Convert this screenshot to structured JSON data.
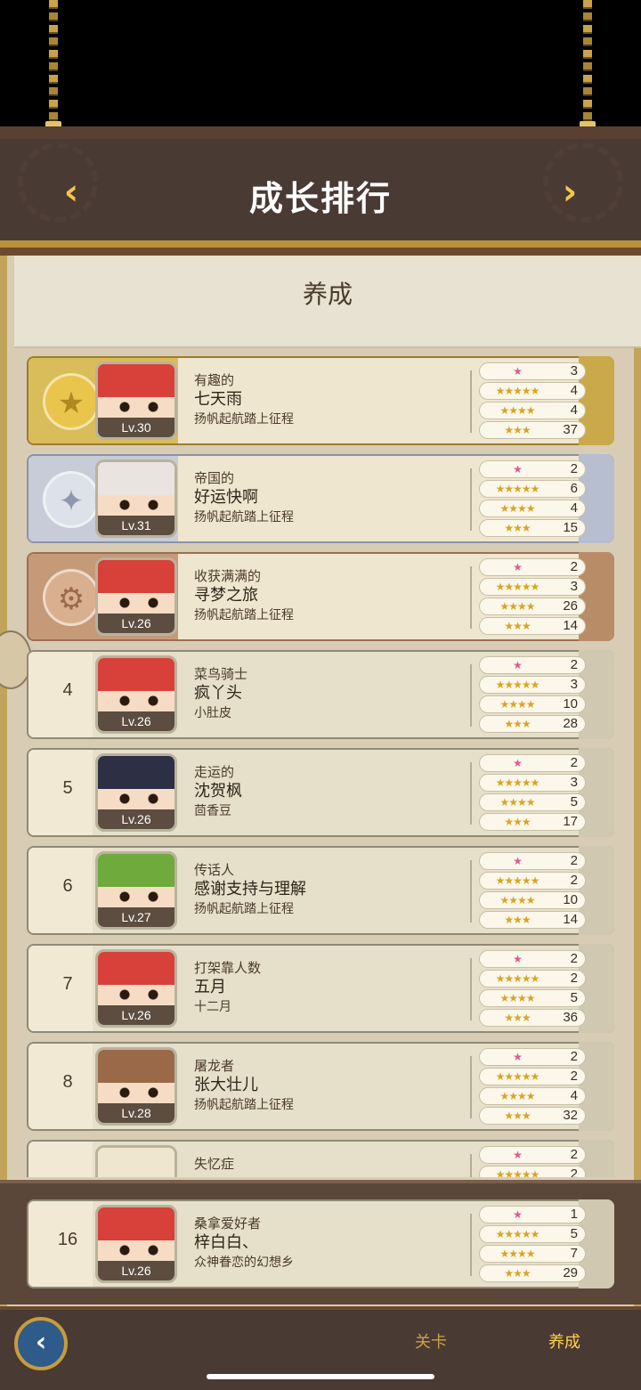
{
  "header": {
    "title": "成长排行",
    "prev_arrow": "‹",
    "next_arrow": "›"
  },
  "panel": {
    "title": "养成"
  },
  "rows": [
    {
      "rank": "1",
      "title": "有趣的",
      "name": "七天雨",
      "guild": "扬帆起航踏上征程",
      "level": "Lv.30",
      "stats": [
        "3",
        "4",
        "4",
        "37"
      ]
    },
    {
      "rank": "2",
      "title": "帝国的",
      "name": "好运快啊",
      "guild": "扬帆起航踏上征程",
      "level": "Lv.31",
      "stats": [
        "2",
        "6",
        "4",
        "15"
      ]
    },
    {
      "rank": "3",
      "title": "收获满满的",
      "name": "寻梦之旅",
      "guild": "扬帆起航踏上征程",
      "level": "Lv.26",
      "stats": [
        "2",
        "3",
        "26",
        "14"
      ]
    },
    {
      "rank": "4",
      "title": "菜鸟骑士",
      "name": "疯丫头",
      "guild": "小肚皮",
      "level": "Lv.26",
      "stats": [
        "2",
        "3",
        "10",
        "28"
      ]
    },
    {
      "rank": "5",
      "title": "走运的",
      "name": "沈贺枫",
      "guild": "茴香豆",
      "level": "Lv.26",
      "stats": [
        "2",
        "3",
        "5",
        "17"
      ]
    },
    {
      "rank": "6",
      "title": "传话人",
      "name": "感谢支持与理解",
      "guild": "扬帆起航踏上征程",
      "level": "Lv.27",
      "stats": [
        "2",
        "2",
        "10",
        "14"
      ]
    },
    {
      "rank": "7",
      "title": "打架靠人数",
      "name": "五月",
      "guild": "十二月",
      "level": "Lv.26",
      "stats": [
        "2",
        "2",
        "5",
        "36"
      ]
    },
    {
      "rank": "8",
      "title": "屠龙者",
      "name": "张大壮儿",
      "guild": "扬帆起航踏上征程",
      "level": "Lv.28",
      "stats": [
        "2",
        "2",
        "4",
        "32"
      ]
    },
    {
      "rank": "",
      "title": "失忆症",
      "name": "",
      "guild": "",
      "level": "",
      "stats": [
        "2",
        "2",
        "",
        ""
      ]
    }
  ],
  "self_row": {
    "rank": "16",
    "title": "桑拿爱好者",
    "name": "梓白白、",
    "guild": "众神眷恋的幻想乡",
    "level": "Lv.26",
    "stats": [
      "1",
      "5",
      "7",
      "29"
    ]
  },
  "stat_icons": [
    "★",
    "★★★★★",
    "★★★★",
    "★★★"
  ],
  "medals": {
    "gold": "★",
    "silver": "✦",
    "bronze": "⚙"
  },
  "bottom": {
    "back_arrow": "‹",
    "tab_level": "关卡",
    "tab_train": "养成"
  },
  "colors": {
    "hair_red": "#d8403a",
    "hair_white": "#e9e4e0",
    "hair_dark": "#2d2f45",
    "hair_green": "#6eaa3c",
    "hair_brown": "#9a6a48"
  }
}
